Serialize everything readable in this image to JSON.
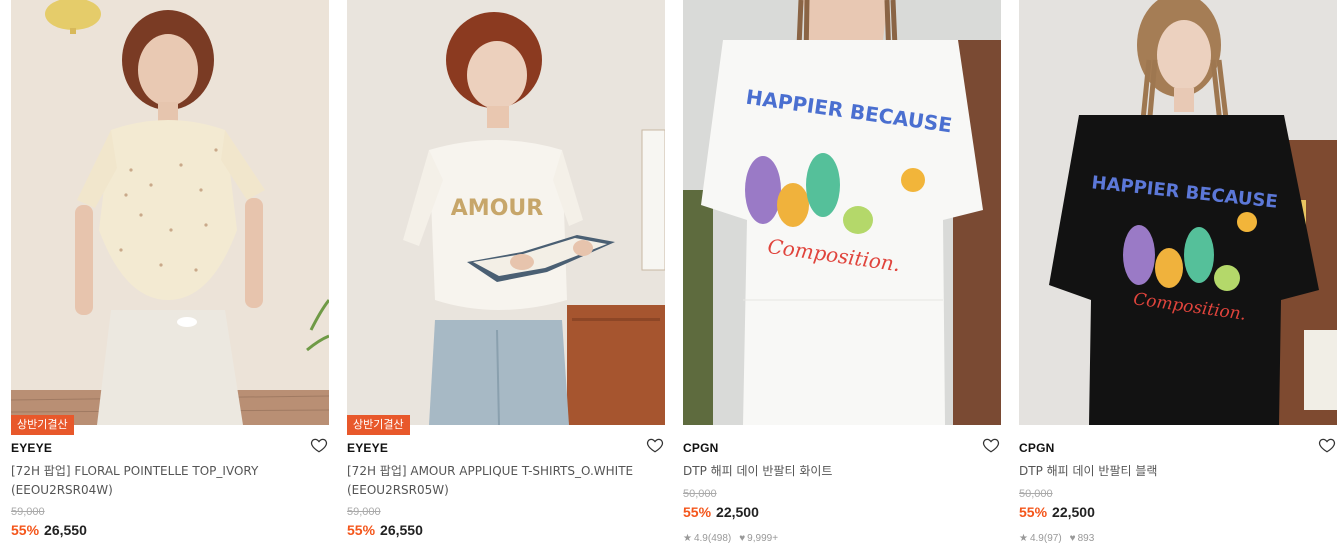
{
  "products": [
    {
      "badge": "상반기결산",
      "brand": "EYEYE",
      "name_line1": "[72H 팝업] FLORAL POINTELLE TOP_IVORY",
      "name_line2": "(EEOU2RSR04W)",
      "original_price": "59,000",
      "discount": "55%",
      "price": "26,550",
      "image": "model-floral-pointelle-top-ivory",
      "wishlist_icon": "heart-outline-icon"
    },
    {
      "badge": "상반기결산",
      "brand": "EYEYE",
      "name_line1": "[72H 팝업] AMOUR APPLIQUE T-SHIRTS_O.WHITE",
      "name_line2": "(EEOU2RSR05W)",
      "original_price": "59,000",
      "discount": "55%",
      "price": "26,550",
      "image": "model-amour-applique-tshirt",
      "print_text": "AMOUR",
      "wishlist_icon": "heart-outline-icon"
    },
    {
      "brand": "CPGN",
      "name_line1": "DTP 해피 데이 반팔티 화이트",
      "original_price": "50,000",
      "discount": "55%",
      "price": "22,500",
      "rating": "4.9",
      "review_count": "(498)",
      "likes": "9,999+",
      "image": "model-happy-day-tee-white",
      "print_text_top": "HAPPIER BECAUSE",
      "print_text_script": "Composition.",
      "wishlist_icon": "heart-outline-icon"
    },
    {
      "brand": "CPGN",
      "name_line1": "DTP 해피 데이 반팔티 블랙",
      "original_price": "50,000",
      "discount": "55%",
      "price": "22,500",
      "rating": "4.9",
      "review_count": "(97)",
      "likes": "893",
      "image": "model-happy-day-tee-black",
      "print_text_top": "HAPPIER BECAUSE",
      "print_text_script": "Composition.",
      "wishlist_icon": "heart-outline-icon"
    }
  ],
  "colors": {
    "badge": "#e8582b",
    "discount": "#f4561b",
    "strike": "#aaaaaa"
  }
}
